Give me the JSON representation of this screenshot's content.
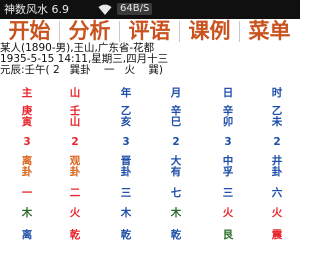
{
  "status": {
    "app_title": "神数风水 6.9",
    "network_speed": "64B/S"
  },
  "menu": [
    "开始",
    "分析",
    "评语",
    "课例",
    "菜单"
  ],
  "info_lines": [
    "某人(1890-男),王山,广东省-花都",
    "1935-5-15 14:11,星期三,四月十三",
    "元辰:壬午( 2   巽卦    一   火    巽)"
  ],
  "table": {
    "colors": {
      "red": "#e8252d",
      "blue": "#1f4fa8",
      "green": "#2a6b2a",
      "orange": "#d9651c"
    },
    "rows": [
      {
        "color": "red",
        "cells": [
          [
            "主"
          ],
          [
            "山"
          ],
          [
            "年"
          ],
          [
            "月"
          ],
          [
            "日"
          ],
          [
            "时"
          ]
        ]
      },
      {
        "color": "red",
        "cells": [
          [
            "庚",
            "寅"
          ],
          [
            "壬",
            "山"
          ],
          [
            "乙",
            "亥"
          ],
          [
            "辛",
            "巳"
          ],
          [
            "辛",
            "卯"
          ],
          [
            "乙",
            "未"
          ]
        ]
      },
      {
        "color": "red",
        "cells": [
          [
            "3"
          ],
          [
            "2"
          ],
          [
            "3"
          ],
          [
            "2"
          ],
          [
            "3"
          ],
          [
            "2"
          ]
        ]
      },
      {
        "color": "orange",
        "cells": [
          [
            "离",
            "卦"
          ],
          [
            "观",
            "卦"
          ],
          [
            "晋",
            "卦"
          ],
          [
            "大",
            "有"
          ],
          [
            "中",
            "孚"
          ],
          [
            "井",
            "卦"
          ]
        ]
      },
      {
        "color": "red",
        "cells": [
          [
            "一"
          ],
          [
            "二"
          ],
          [
            "三"
          ],
          [
            "七"
          ],
          [
            "三"
          ],
          [
            "六"
          ]
        ]
      },
      {
        "color": "red",
        "cells": [
          [
            "木"
          ],
          [
            "火"
          ],
          [
            "木"
          ],
          [
            "木"
          ],
          [
            "火"
          ],
          [
            "火"
          ]
        ]
      },
      {
        "color": "blue",
        "cells": [
          [
            "离"
          ],
          [
            "乾"
          ],
          [
            "乾"
          ],
          [
            "乾"
          ],
          [
            "艮"
          ],
          [
            "震"
          ]
        ]
      }
    ],
    "cell_colors": [
      [
        "red",
        "red",
        "blue",
        "blue",
        "blue",
        "blue"
      ],
      [
        "red",
        "red",
        "blue",
        "blue",
        "blue",
        "blue"
      ],
      [
        "red",
        "red",
        "blue",
        "blue",
        "blue",
        "blue"
      ],
      [
        "orange",
        "orange",
        "blue",
        "blue",
        "blue",
        "blue"
      ],
      [
        "red",
        "red",
        "blue",
        "blue",
        "blue",
        "blue"
      ],
      [
        "green",
        "red",
        "blue",
        "green",
        "red",
        "red"
      ],
      [
        "blue",
        "red",
        "blue",
        "blue",
        "green",
        "red"
      ]
    ]
  }
}
